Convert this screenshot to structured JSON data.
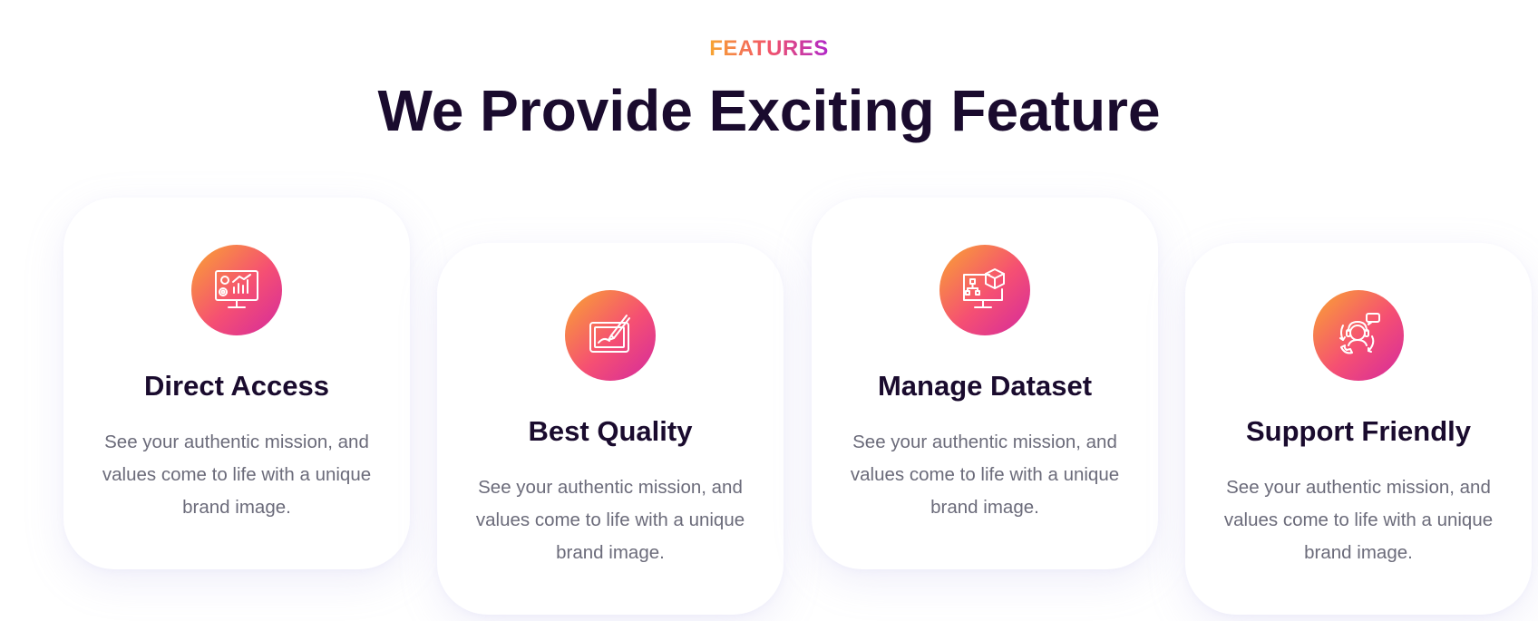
{
  "section": {
    "eyebrow": "FEATURES",
    "heading": "We Provide Exciting Feature"
  },
  "colors": {
    "heading": "#1a0b2e",
    "body_text": "#6b6b7a",
    "gradient_start": "#f9a531",
    "gradient_mid": "#f54f73",
    "gradient_end": "#d42a9e"
  },
  "features": [
    {
      "icon": "monitor-analytics-icon",
      "title": "Direct Access",
      "description": "See your authentic mission, and values come to life with a unique brand image."
    },
    {
      "icon": "drawing-tablet-icon",
      "title": "Best Quality",
      "description": "See your authentic mission, and values come to life with a unique brand image."
    },
    {
      "icon": "monitor-dataset-icon",
      "title": "Manage Dataset",
      "description": "See your authentic mission, and values come to life with a unique brand image."
    },
    {
      "icon": "customer-support-icon",
      "title": "Support Friendly",
      "description": "See your authentic mission, and values come to life with a unique brand image."
    }
  ]
}
